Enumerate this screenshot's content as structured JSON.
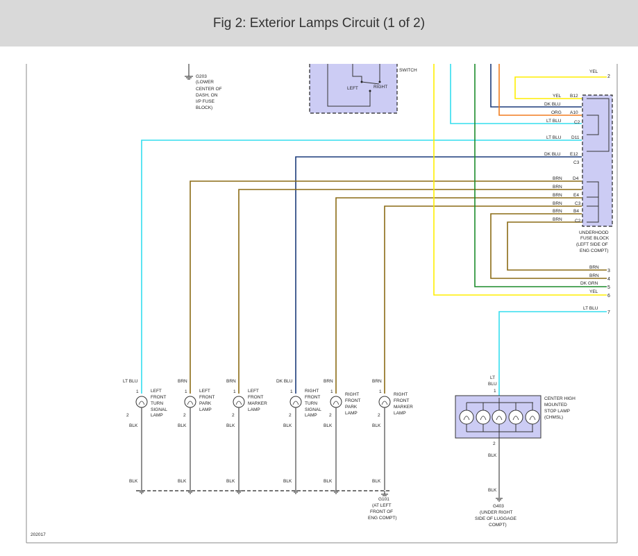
{
  "title": "Fig 2: Exterior Lamps Circuit (1 of 2)",
  "figure_id": "202017",
  "colors": {
    "yellow": "#ffee00",
    "light_blue": "#33ddee",
    "dark_blue": "#1a3a7a",
    "orange": "#f07c1e",
    "dark_green": "#1a8a2a",
    "brown": "#8a6a14",
    "block_fill": "#ccccf4"
  },
  "g203": {
    "id": "G203",
    "desc1": "(LOWER",
    "desc2": "CENTER OF",
    "desc3": "DASH, ON",
    "desc4": "I/P FUSE",
    "desc5": "BLOCK)"
  },
  "headlamp_switch": {
    "label": "SWITCH",
    "left": "LEFT",
    "right": "RIGHT"
  },
  "fuse_block": {
    "name1": "UNDERHOOD",
    "name2": "FUSE BLOCK",
    "name3": "(LEFT SIDE OF",
    "name4": "ENG COMPT)",
    "rows": [
      {
        "wire": "YEL",
        "pin": "B12"
      },
      {
        "wire": "DK BLU",
        "pin": ""
      },
      {
        "wire": "ORG",
        "pin": "A10"
      },
      {
        "wire": "LT BLU",
        "pin": "C2"
      },
      {
        "wire": "LT BLU",
        "pin": "D11"
      },
      {
        "wire": "DK BLU",
        "pin": "E12"
      },
      {
        "wire": "",
        "pin": "C3"
      },
      {
        "wire": "BRN",
        "pin": "D4"
      },
      {
        "wire": "BRN",
        "pin": ""
      },
      {
        "wire": "BRN",
        "pin": "E4"
      },
      {
        "wire": "BRN",
        "pin": "C3"
      },
      {
        "wire": "BRN",
        "pin": "B4"
      },
      {
        "wire": "BRN",
        "pin": "C2"
      }
    ]
  },
  "offpage": [
    {
      "wire": "YEL",
      "num": "2"
    },
    {
      "wire": "BRN",
      "num": "3"
    },
    {
      "wire": "BRN",
      "num": "4"
    },
    {
      "wire": "DK GRN",
      "num": "5"
    },
    {
      "wire": "YEL",
      "num": "6"
    },
    {
      "wire": "LT BLU",
      "num": "7"
    }
  ],
  "lamps": [
    {
      "wire": "LT BLU",
      "l1": "LEFT",
      "l2": "FRONT",
      "l3": "TURN",
      "l4": "SIGNAL",
      "l5": "LAMP",
      "pin1": "1",
      "pin2": "2",
      "gnd": "BLK",
      "gnd2": "BLK"
    },
    {
      "wire": "BRN",
      "l1": "LEFT",
      "l2": "FRONT",
      "l3": "PARK",
      "l4": "LAMP",
      "l5": "",
      "pin1": "1",
      "pin2": "2",
      "gnd": "BLK",
      "gnd2": "BLK"
    },
    {
      "wire": "BRN",
      "l1": "LEFT",
      "l2": "FRONT",
      "l3": "MARKER",
      "l4": "LAMP",
      "l5": "",
      "pin1": "1",
      "pin2": "2",
      "gnd": "BLK",
      "gnd2": "BLK"
    },
    {
      "wire": "DK BLU",
      "l1": "RIGHT",
      "l2": "FRONT",
      "l3": "TURN",
      "l4": "SIGNAL",
      "l5": "LAMP",
      "pin1": "1",
      "pin2": "2",
      "gnd": "BLK",
      "gnd2": "BLK"
    },
    {
      "wire": "BRN",
      "l1": "RIGHT",
      "l2": "FRONT",
      "l3": "PARK",
      "l4": "LAMP",
      "l5": "",
      "pin1": "1",
      "pin2": "2",
      "gnd": "BLK",
      "gnd2": "BLK"
    },
    {
      "wire": "BRN",
      "l1": "RIGHT",
      "l2": "FRONT",
      "l3": "MARKER",
      "l4": "LAMP",
      "l5": "",
      "pin1": "1",
      "pin2": "2",
      "gnd": "BLK",
      "gnd2": "BLK"
    }
  ],
  "g101": {
    "id": "G101",
    "d1": "(AT LEFT",
    "d2": "FRONT OF",
    "d3": "ENG COMPT)"
  },
  "chmsl": {
    "wire1": "LT",
    "wire2": "BLU",
    "pin1": "1",
    "pin2": "2",
    "gnd1": "BLK",
    "gnd2": "BLK",
    "l1": "CENTER HIGH",
    "l2": "MOUNTED",
    "l3": "STOP LAMP",
    "l4": "(CHMSL)"
  },
  "g403": {
    "id": "G403",
    "d1": "(UNDER RIGHT",
    "d2": "SIDE OF LUGGAGE",
    "d3": "COMPT)"
  }
}
